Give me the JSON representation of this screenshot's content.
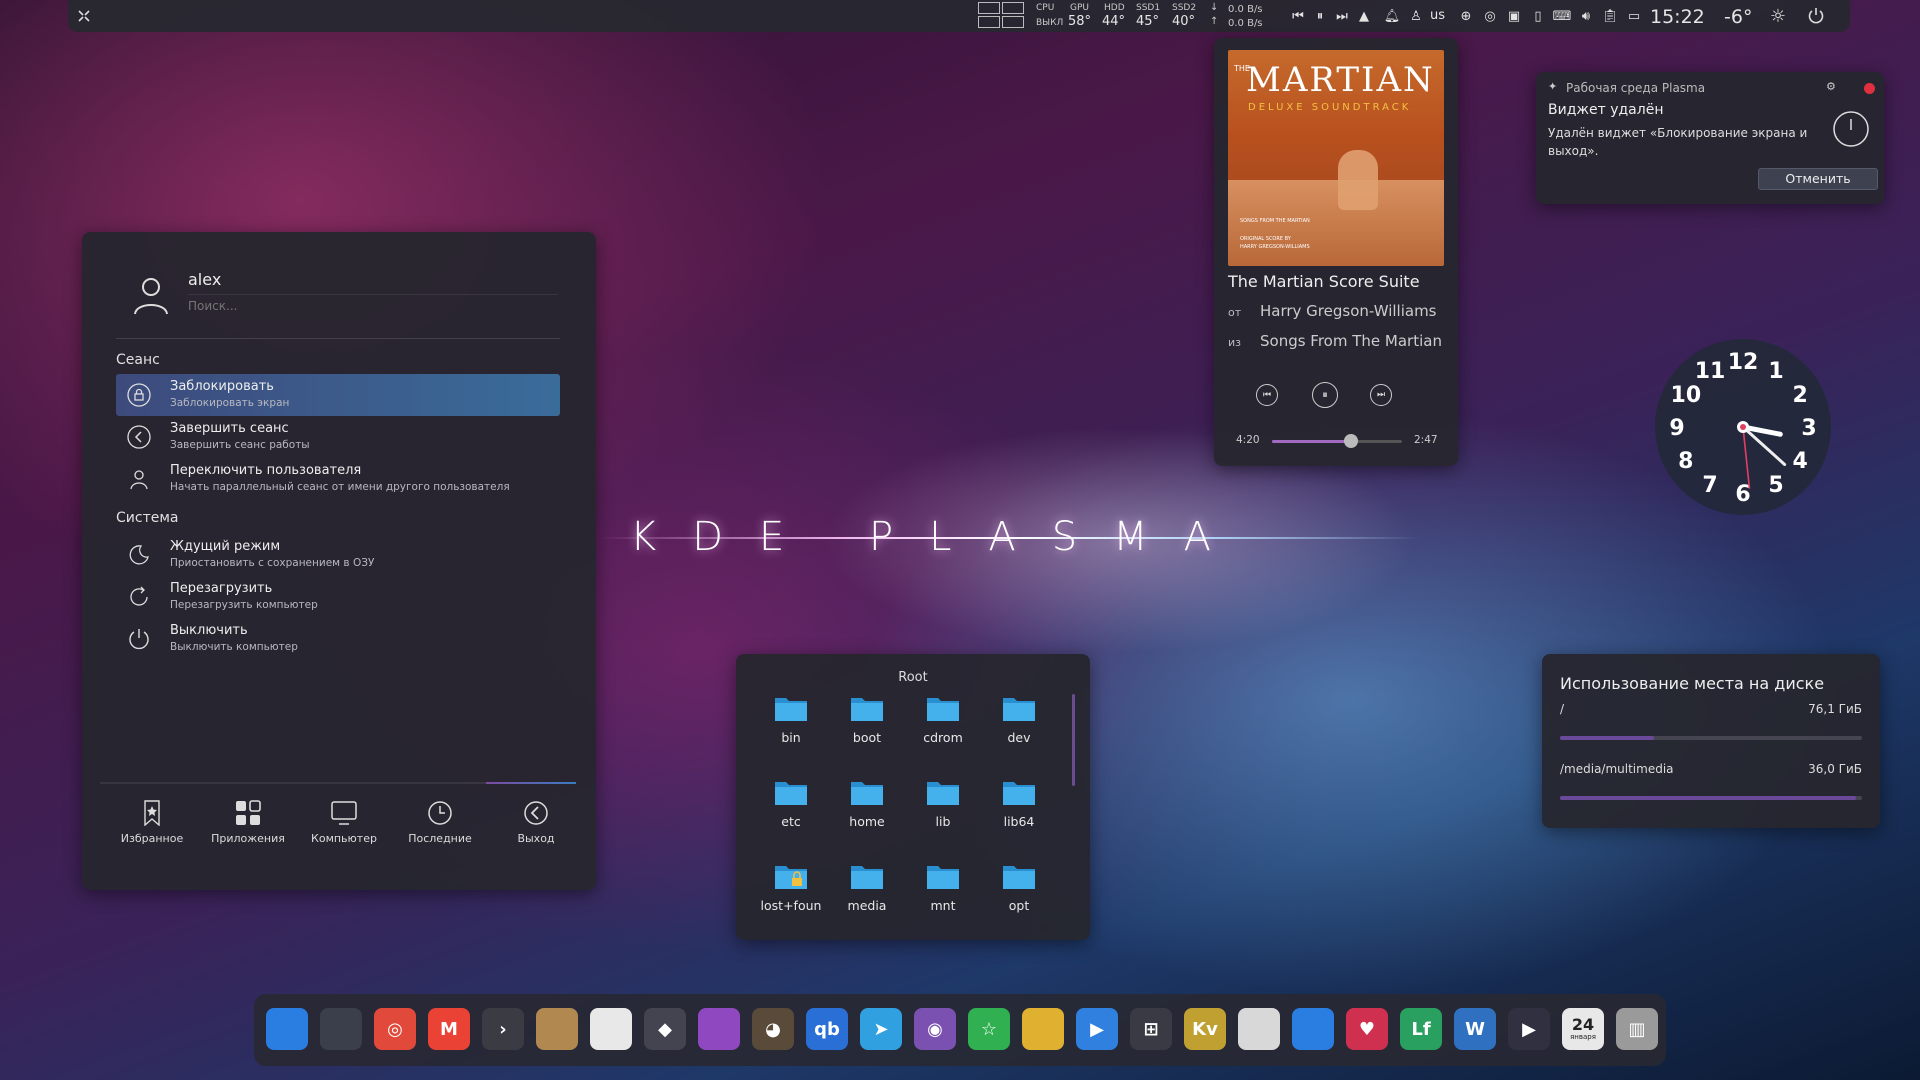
{
  "topbar": {
    "sensors": {
      "cpu_label": "CPU",
      "cpu_state": "ВЫКЛ",
      "gpu_label": "GPU",
      "gpu_temp": "58°",
      "hdd_label": "HDD",
      "hdd_temp": "44°",
      "ssd1_label": "SSD1",
      "ssd1_temp": "45°",
      "ssd2_label": "SSD2",
      "ssd2_temp": "40°"
    },
    "network": {
      "down": "0.0 B/s",
      "up": "0.0 B/s"
    },
    "keyboard_layout": "us",
    "time": "15:22",
    "weather_temp": "-6°"
  },
  "wallpaper": {
    "logo_text": "KDE PLASMA"
  },
  "kickoff": {
    "user": "alex",
    "search_placeholder": "Поиск...",
    "sections": {
      "session": "Сеанс",
      "system": "Система"
    },
    "items": [
      {
        "title": "Заблокировать",
        "subtitle": "Заблокировать экран",
        "icon": "lock-icon",
        "active": true
      },
      {
        "title": "Завершить сеанс",
        "subtitle": "Завершить сеанс работы",
        "icon": "logout-icon"
      },
      {
        "title": "Переключить пользователя",
        "subtitle": "Начать параллельный сеанс от имени другого пользователя",
        "icon": "switch-user-icon"
      },
      {
        "title": "Ждущий режим",
        "subtitle": "Приостановить с сохранением в ОЗУ",
        "icon": "sleep-icon"
      },
      {
        "title": "Перезагрузить",
        "subtitle": "Перезагрузить компьютер",
        "icon": "restart-icon"
      },
      {
        "title": "Выключить",
        "subtitle": "Выключить компьютер",
        "icon": "power-icon"
      }
    ],
    "tabs": [
      {
        "label": "Избранное",
        "icon": "bookmark-icon"
      },
      {
        "label": "Приложения",
        "icon": "apps-icon"
      },
      {
        "label": "Компьютер",
        "icon": "computer-icon"
      },
      {
        "label": "Последние",
        "icon": "clock-icon"
      },
      {
        "label": "Выход",
        "icon": "leave-icon"
      }
    ]
  },
  "player": {
    "album_title_line1": "THE",
    "album_title": "MARTIAN",
    "album_subtitle": "DELUXE SOUNDTRACK",
    "album_small_1": "SONGS FROM THE MARTIAN",
    "album_small_2": "ORIGINAL SCORE BY",
    "album_small_3": "HARRY GREGSON-WILLIAMS",
    "track": "The Martian Score Suite",
    "by_label": "от",
    "artist": "Harry Gregson-Williams",
    "from_label": "из",
    "album": "Songs From The Martian",
    "elapsed": "4:20",
    "remaining": "2:47",
    "progress_fraction": 0.61
  },
  "notification": {
    "app": "Рабочая среда Plasma",
    "title": "Виджет удалён",
    "body": "Удалён виджет «Блокирование экрана и выход».",
    "undo_label": "Отменить"
  },
  "clock": {
    "numbers": [
      "12",
      "1",
      "2",
      "3",
      "4",
      "5",
      "6",
      "7",
      "8",
      "9",
      "10",
      "11"
    ],
    "hour": 3,
    "minute": 22,
    "second": 29
  },
  "folder_view": {
    "title": "Root",
    "items": [
      "bin",
      "boot",
      "cdrom",
      "dev",
      "etc",
      "home",
      "lib",
      "lib64",
      "lost+foun",
      "media",
      "mnt",
      "opt"
    ]
  },
  "disk_usage": {
    "title": "Использование места на диске",
    "mounts": [
      {
        "path": "/",
        "free": "76,1 ГиБ",
        "used_fraction": 0.31
      },
      {
        "path": "/media/multimedia",
        "free": "36,0 ГиБ",
        "used_fraction": 0.98
      }
    ]
  },
  "calendar_icon": {
    "day": "24",
    "month": "января"
  },
  "dock": {
    "apps": [
      "file-manager-icon",
      "settings-icon",
      "chrome-icon",
      "gmail-icon",
      "terminal-icon",
      "archive-icon",
      "text-editor-icon",
      "inkscape-icon",
      "color-picker-icon",
      "gimp-icon",
      "qbittorrent-icon",
      "telegram-icon",
      "github-icon",
      "favorites-icon",
      "camera-icon",
      "video-player-icon",
      "calculator-icon",
      "kvantum-icon",
      "mixer-icon",
      "folder-icon",
      "heart-icon",
      "lf-icon",
      "wps-icon",
      "media-icon",
      "calendar-icon",
      "trash-icon"
    ],
    "colors": [
      "#2a7de1",
      "#3a3f4b",
      "#e14a3b",
      "#ea4335",
      "#3b3b44",
      "#b08850",
      "#e8e8e8",
      "#444450",
      "#9048c0",
      "#5a4a3a",
      "#2a6fd6",
      "#30a0e0",
      "#7a50b0",
      "#30b050",
      "#e0b030",
      "#3080e0",
      "#3a3a44",
      "#c0a030",
      "#d8d8d8",
      "#2a7de1",
      "#d03050",
      "#2aa060",
      "#3070c0",
      "#303040",
      "#e8e8e8",
      "#9a9a9a"
    ]
  }
}
